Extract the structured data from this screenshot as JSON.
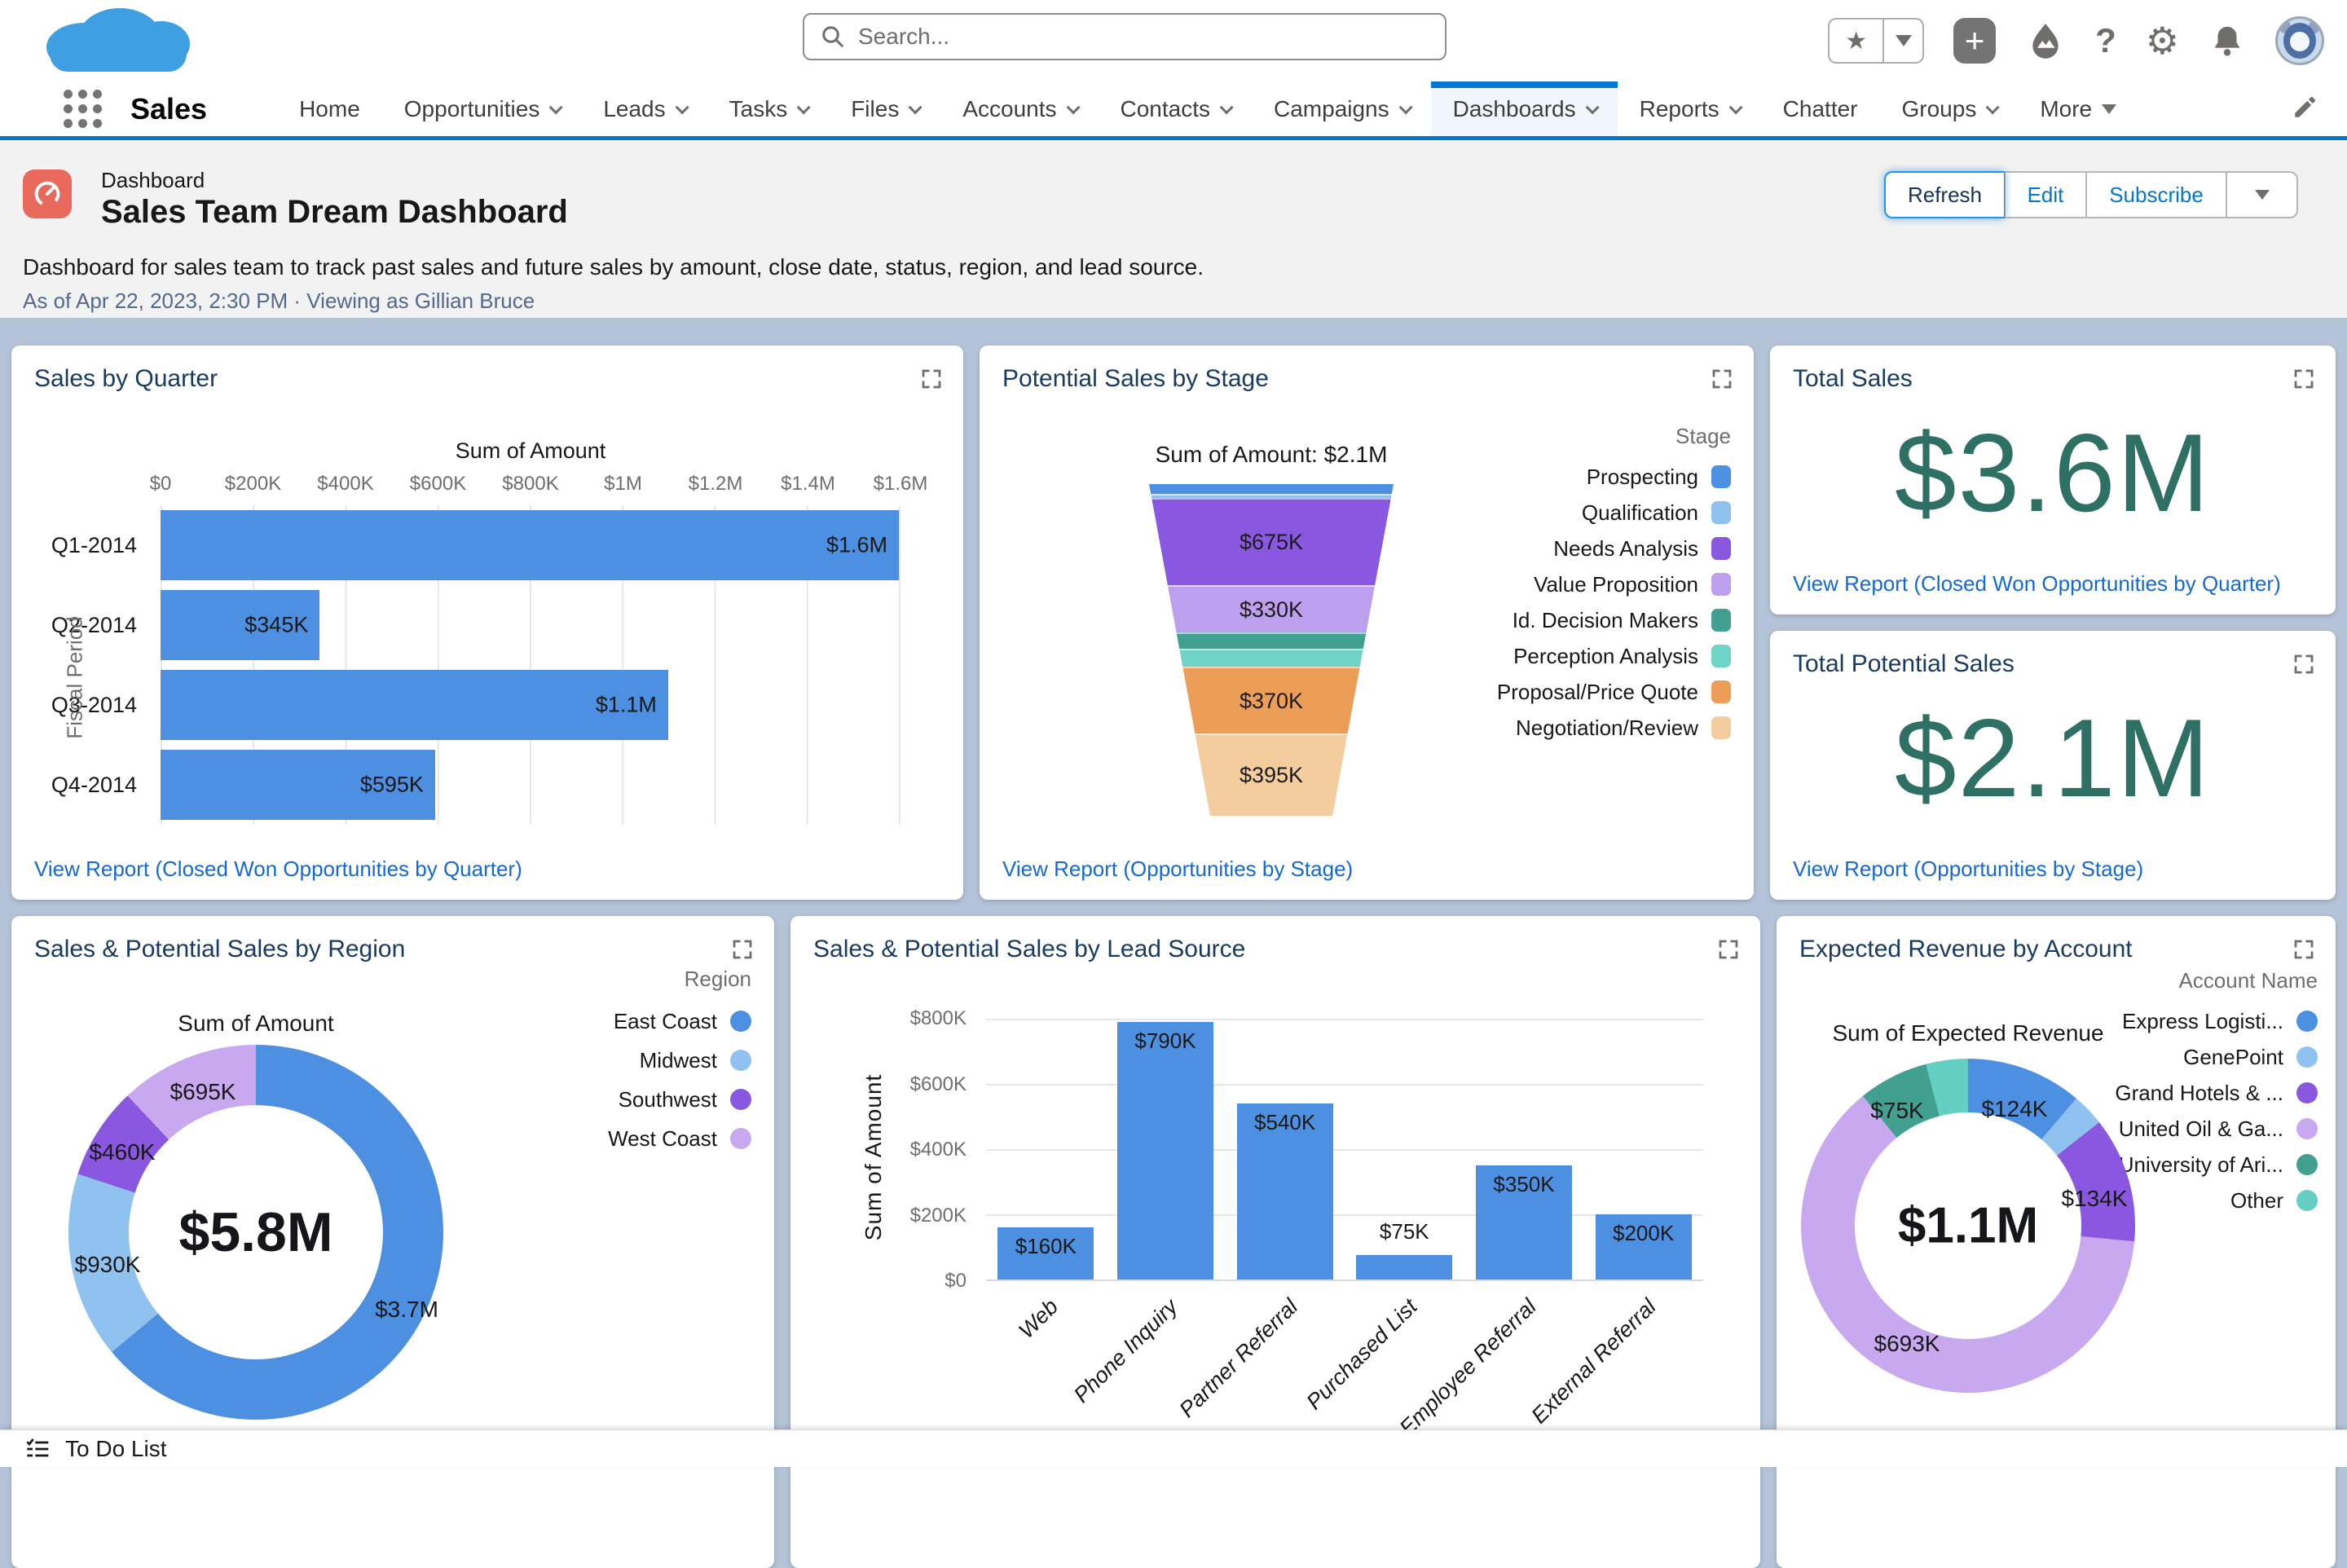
{
  "global_header": {
    "search": {
      "placeholder": "Search..."
    },
    "icons": {
      "favorites_star": "★",
      "plus": "+",
      "help": "?",
      "gear": "⚙"
    }
  },
  "nav": {
    "app_name": "Sales",
    "tabs": [
      {
        "label": "Home"
      },
      {
        "label": "Opportunities"
      },
      {
        "label": "Leads"
      },
      {
        "label": "Tasks"
      },
      {
        "label": "Files"
      },
      {
        "label": "Accounts"
      },
      {
        "label": "Contacts"
      },
      {
        "label": "Campaigns"
      },
      {
        "label": "Dashboards",
        "active": true
      },
      {
        "label": "Reports"
      },
      {
        "label": "Chatter"
      },
      {
        "label": "Groups"
      },
      {
        "label": "More"
      }
    ]
  },
  "page_header": {
    "record_type": "Dashboard",
    "title": "Sales Team Dream Dashboard",
    "description": "Dashboard for sales team to track past sales and future sales by amount, close date, status, region, and lead source.",
    "as_of": "As of Apr 22, 2023, 2:30 PM · Viewing as Gillian Bruce",
    "actions": {
      "refresh": "Refresh",
      "edit": "Edit",
      "subscribe": "Subscribe"
    }
  },
  "cards": {
    "quarter": {
      "title": "Sales by Quarter",
      "view_report": "View Report (Closed Won Opportunities by Quarter)",
      "chart_data": {
        "type": "bar",
        "orientation": "horizontal",
        "axis_title": "Sum of Amount",
        "category_axis_label": "Fiscal Period",
        "categories": [
          "Q1-2014",
          "Q2-2014",
          "Q3-2014",
          "Q4-2014"
        ],
        "values": [
          1600000,
          345000,
          1100000,
          595000
        ],
        "value_labels": [
          "$1.6M",
          "$345K",
          "$1.1M",
          "$595K"
        ],
        "x_ticks": [
          "$0",
          "$200K",
          "$400K",
          "$600K",
          "$800K",
          "$1M",
          "$1.2M",
          "$1.4M",
          "$1.6M"
        ],
        "xlim": [
          0,
          1600000
        ],
        "bar_color": "#4D90E1",
        "grid": true
      }
    },
    "stage": {
      "title": "Potential Sales by Stage",
      "view_report": "View Report (Opportunities by Stage)",
      "chart_data": {
        "type": "funnel",
        "header": "Sum of Amount: $2.1M",
        "legend_title": "Stage",
        "legend_position": "right",
        "segments": [
          {
            "stage": "Prospecting",
            "label": "",
            "color": "#4D90E1",
            "height": 12
          },
          {
            "stage": "Qualification",
            "label": "",
            "color": "#8FC2EF",
            "height": 5
          },
          {
            "stage": "Needs Analysis",
            "label": "$675K",
            "color": "#8A57E0",
            "height": 107
          },
          {
            "stage": "Value Proposition",
            "label": "$330K",
            "color": "#BCA0ED",
            "height": 58
          },
          {
            "stage": "Id. Decision Makers",
            "label": "",
            "color": "#42A091",
            "height": 20
          },
          {
            "stage": "Perception Analysis",
            "label": "",
            "color": "#6FD4C8",
            "height": 22
          },
          {
            "stage": "Proposal/Price Quote",
            "label": "$370K",
            "color": "#EC9D56",
            "height": 82
          },
          {
            "stage": "Negotiation/Review",
            "label": "$395K",
            "color": "#F4CD9E",
            "height": 101
          }
        ]
      }
    },
    "total_sales": {
      "title": "Total Sales",
      "value": "$3.6M",
      "view_report": "View Report (Closed Won Opportunities by Quarter)"
    },
    "total_potential": {
      "title": "Total Potential Sales",
      "value": "$2.1M",
      "view_report": "View Report (Opportunities by Stage)"
    },
    "region": {
      "title": "Sales & Potential Sales by Region",
      "chart_data": {
        "type": "pie",
        "donut": true,
        "axis_title": "Sum of Amount",
        "center_label": "$5.8M",
        "legend_title": "Region",
        "legend_position": "right",
        "segments": [
          {
            "name": "East Coast",
            "value": 3700000,
            "label": "$3.7M",
            "color": "#4D90E1"
          },
          {
            "name": "Midwest",
            "value": 930000,
            "label": "$930K",
            "color": "#8FC2EF"
          },
          {
            "name": "Southwest",
            "value": 460000,
            "label": "$460K",
            "color": "#8A57E0"
          },
          {
            "name": "West Coast",
            "value": 695000,
            "label": "$695K",
            "color": "#C8A9F0"
          }
        ]
      }
    },
    "lead": {
      "title": "Sales & Potential Sales by Lead Source",
      "chart_data": {
        "type": "bar",
        "orientation": "vertical",
        "ylabel": "Sum of Amount",
        "y_ticks": [
          "$800K",
          "$600K",
          "$400K",
          "$200K",
          "$0"
        ],
        "ylim": [
          0,
          800000
        ],
        "categories": [
          "Web",
          "Phone Inquiry",
          "Partner Referral",
          "Purchased List",
          "Employee Referral",
          "External Referral"
        ],
        "values": [
          160000,
          790000,
          540000,
          75000,
          350000,
          200000
        ],
        "value_labels": [
          "$160K",
          "$790K",
          "$540K",
          "$75K",
          "$350K",
          "$200K"
        ],
        "bar_color": "#4D90E1",
        "grid": true
      }
    },
    "account": {
      "title": "Expected Revenue by Account",
      "chart_data": {
        "type": "pie",
        "donut": true,
        "axis_title": "Sum of Expected Revenue",
        "center_label": "$1.1M",
        "legend_title": "Account Name",
        "legend_position": "right",
        "segments": [
          {
            "name": "Express Logisti...",
            "value": 124000,
            "label": "$124K",
            "color": "#4D90E1"
          },
          {
            "name": "GenePoint",
            "value": 35000,
            "label": "",
            "color": "#8FC2EF"
          },
          {
            "name": "Grand Hotels & ...",
            "value": 134000,
            "label": "$134K",
            "color": "#8A57E0"
          },
          {
            "name": "United Oil & Ga...",
            "value": 693000,
            "label": "$693K",
            "color": "#C8A9F0"
          },
          {
            "name": "University of Ari...",
            "value": 75000,
            "label": "$75K",
            "color": "#42A091"
          },
          {
            "name": "Other",
            "value": 45000,
            "label": "",
            "color": "#66CFC4"
          }
        ]
      }
    }
  },
  "footer": {
    "todo": "To Do List"
  }
}
